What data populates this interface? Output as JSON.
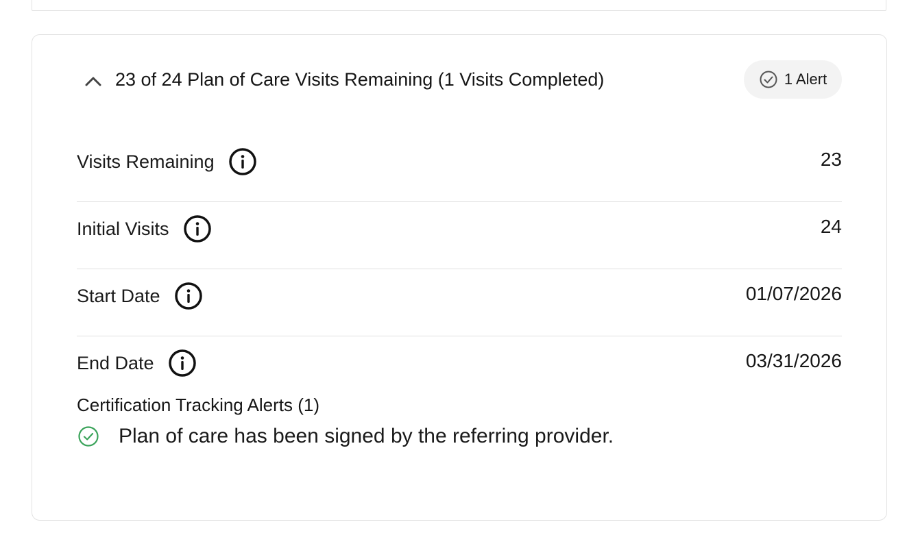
{
  "plan_of_care": {
    "header_title": "23 of 24 Plan of Care Visits Remaining (1 Visits Completed)",
    "alert_chip_label": "1 Alert",
    "rows": [
      {
        "label": "Visits Remaining",
        "value": "23"
      },
      {
        "label": "Initial Visits",
        "value": "24"
      },
      {
        "label": "Start Date",
        "value": "01/07/2026"
      },
      {
        "label": "End Date",
        "value": "03/31/2026"
      }
    ],
    "alerts": {
      "title": "Certification Tracking Alerts (1)",
      "items": [
        {
          "text": "Plan of care has been signed by the referring provider.",
          "status": "complete"
        }
      ]
    }
  },
  "colors": {
    "success_green": "#3aa35a",
    "chip_background": "#f3f3f3",
    "border": "#e2e2e2"
  },
  "icons": {
    "collapse": "chevron-up-icon",
    "alert_chip": "check-circle-icon",
    "info": "info-icon",
    "alert_item": "check-circle-icon"
  }
}
